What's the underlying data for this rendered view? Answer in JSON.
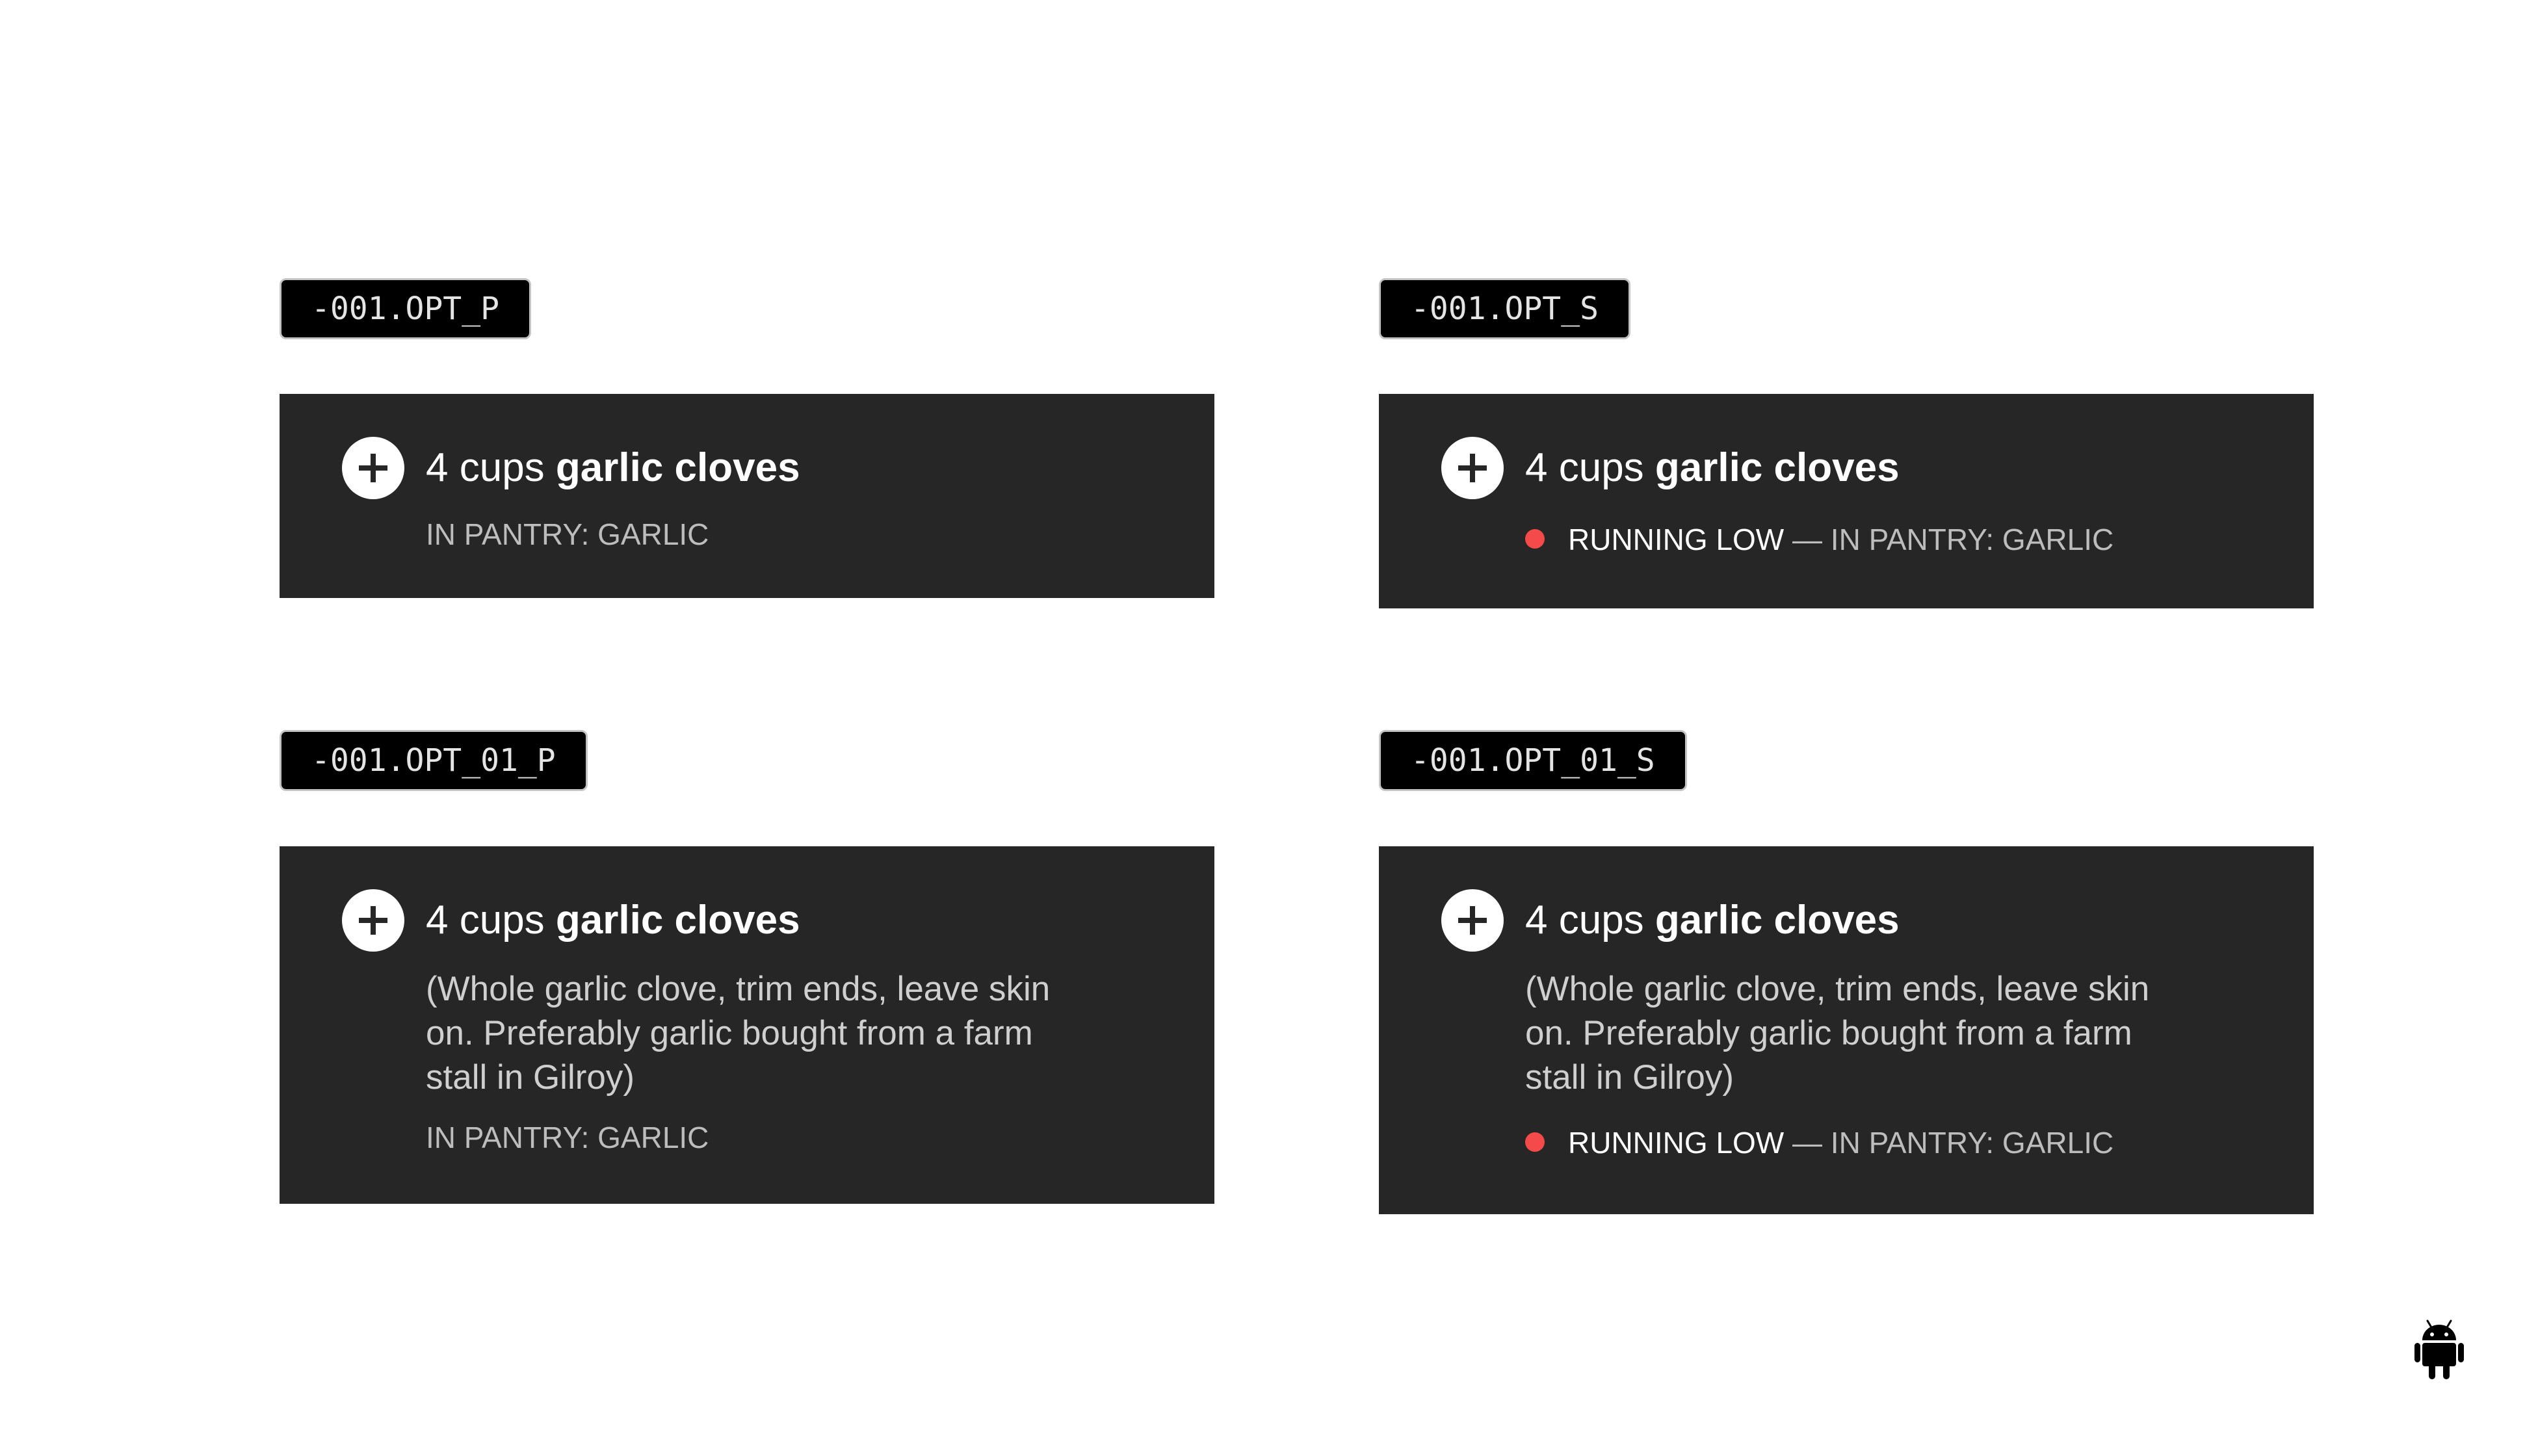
{
  "variants": [
    {
      "tag": "-001.OPT_P",
      "quantity": "4 cups",
      "ingredient": "garlic cloves",
      "pantry": "IN PANTRY: GARLIC"
    },
    {
      "tag": "-001.OPT_S",
      "quantity": "4 cups",
      "ingredient": "garlic cloves",
      "status_low": "RUNNING LOW",
      "status_rest": " — IN PANTRY: GARLIC"
    },
    {
      "tag": "-001.OPT_01_P",
      "quantity": "4 cups",
      "ingredient": "garlic cloves",
      "note": "(Whole garlic clove, trim ends, leave skin on. Preferably garlic bought from a farm stall in Gilroy)",
      "pantry": "IN PANTRY: GARLIC"
    },
    {
      "tag": "-001.OPT_01_S",
      "quantity": "4 cups",
      "ingredient": "garlic cloves",
      "note": "(Whole garlic clove, trim ends, leave skin on. Preferably garlic bought from a farm stall in Gilroy)",
      "status_low": "RUNNING LOW",
      "status_rest": " — IN PANTRY: GARLIC"
    }
  ],
  "icons": {
    "add": "plus-circle-icon",
    "status": "red-dot-icon",
    "platform": "android-icon"
  },
  "colors": {
    "card_background": "#262626",
    "tag_background": "#000000",
    "status_dot": "#f44a4a",
    "page_background": "#ffffff"
  }
}
